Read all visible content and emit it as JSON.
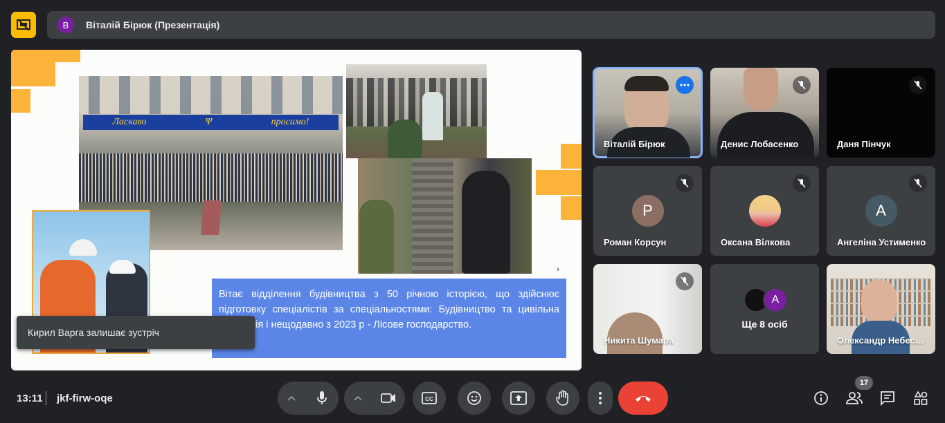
{
  "header": {
    "presenter_initial": "В",
    "title": "Віталій Бірюк (Презентація)"
  },
  "slide": {
    "banner_left": "Ласкаво",
    "banner_right": "просимо!",
    "caption": "Вітає відділення будівництва з 50 річною історією, що здійснює підготовку спеціалістів за спеціальностями: Будівництво та цивільна інженерія і нещодавно з 2023 р - Лісове господарство."
  },
  "toast": {
    "text": "Кирил Варга залишає зустріч"
  },
  "participants": [
    {
      "name": "Віталій Бірюк",
      "type": "video",
      "muted": false,
      "active": true
    },
    {
      "name": "Денис Лобасенко",
      "type": "video",
      "muted": true
    },
    {
      "name": "Даня Пінчук",
      "type": "dark",
      "muted": true
    },
    {
      "name": "Роман Корсун",
      "type": "avatar",
      "initial": "Р",
      "color": "#8d6e63",
      "muted": true
    },
    {
      "name": "Оксана Вілкова",
      "type": "photo",
      "muted": true
    },
    {
      "name": "Ангеліна Устименко",
      "type": "avatar",
      "initial": "А",
      "color": "#455a64",
      "muted": true
    },
    {
      "name": "Никита Шумара",
      "type": "video",
      "muted": true
    },
    {
      "name": "Ще 8 осіб",
      "type": "more",
      "initial": "А",
      "color": "#7b1fa2"
    },
    {
      "name": "Олександр Небесний",
      "type": "video",
      "muted": false
    }
  ],
  "bottom": {
    "time": "13:11",
    "meeting_code": "jkf-firw-oqe",
    "people_count": "17"
  },
  "colors": {
    "accent": "#8ab4f8",
    "hangup": "#ea4335",
    "present": "#fbbc04",
    "slide_orange": "#fbb33a",
    "caption_blue": "#5b86e8"
  }
}
